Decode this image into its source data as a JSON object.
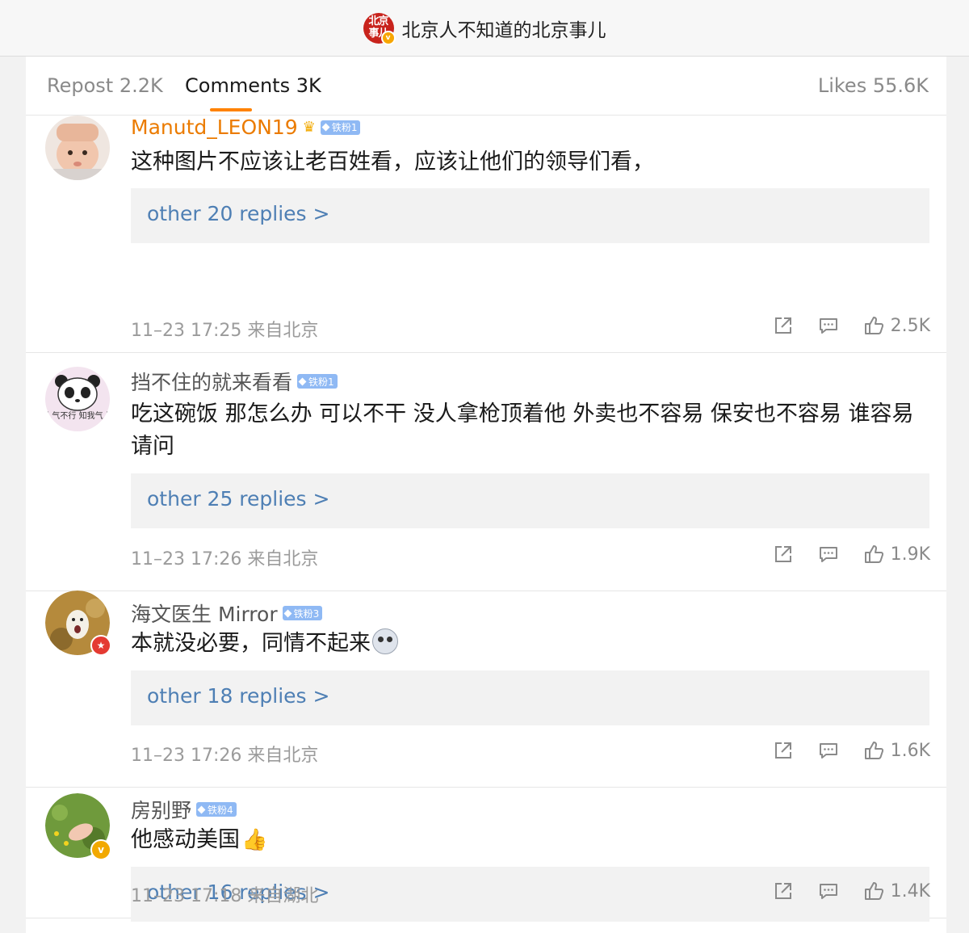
{
  "header": {
    "account_name": "北京人不知道的北京事儿",
    "logo_text": "北京事儿"
  },
  "tabs": {
    "repost": "Repost 2.2K",
    "comments": "Comments 3K",
    "likes": "Likes 55.6K"
  },
  "colors": {
    "accent": "#ff8200",
    "link": "#4e7fb4",
    "vip_name": "#eb7b00",
    "fan_badge": "#8fb9f4"
  },
  "comments": [
    {
      "username": "Manutd_LEON19",
      "badge": "铁粉1",
      "text": "这种图片不应该让老百姓看，应该让他们的领导们看，",
      "replies": "other 20 replies >",
      "meta": "11–23 17:25 来自北京",
      "likes": "2.5K",
      "avatar_icon": "baby-photo-avatar"
    },
    {
      "username": "挡不住的就来看看",
      "badge": "铁粉1",
      "text": "吃这碗饭 那怎么办 可以不干 没人拿枪顶着他 外卖也不容易 保安也不容易 谁容易 请问",
      "replies": "other 25 replies >",
      "meta": "11–23 17:26 来自北京",
      "likes": "1.9K",
      "avatar_icon": "panda-avatar",
      "avatar_text": "我人气不行 知我气人行"
    },
    {
      "username": "海文医生 Mirror",
      "badge": "铁粉3",
      "text": "本就没必要，同情不起来",
      "replies": "other 18 replies >",
      "meta": "11–23 17:26 来自北京",
      "likes": "1.6K",
      "avatar_icon": "dog-photo-avatar"
    },
    {
      "username": "房别野",
      "badge": "铁粉4",
      "text": "他感动美国",
      "replies": "other 16 replies >",
      "meta": "11–23 17:18 来自湖北",
      "likes": "1.4K",
      "avatar_icon": "grass-photo-avatar"
    }
  ]
}
